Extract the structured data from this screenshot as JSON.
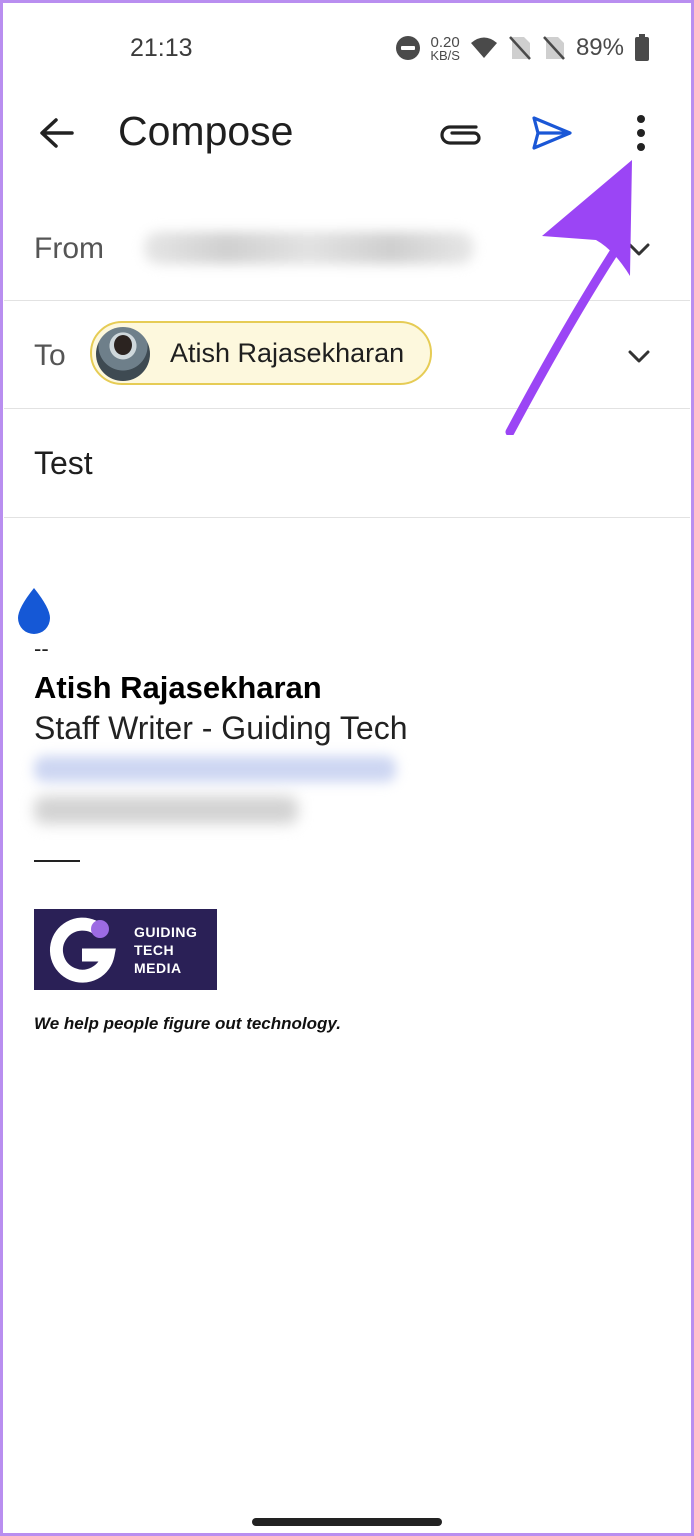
{
  "status_bar": {
    "time": "21:13",
    "net_speed_value": "0.20",
    "net_speed_unit": "KB/S",
    "battery": "89%",
    "icons": [
      "do-not-disturb-icon",
      "wifi-icon",
      "no-sim-icon",
      "no-sim-icon",
      "battery-icon"
    ]
  },
  "app_bar": {
    "title": "Compose",
    "icons": [
      "back-arrow-icon",
      "attachment-icon",
      "send-icon",
      "more-vert-icon"
    ]
  },
  "compose": {
    "from_label": "From",
    "to_label": "To",
    "to_recipient": "Atish Rajasekharan",
    "subject": "Test"
  },
  "body": {
    "signature_dash": "--",
    "signature_name": "Atish Rajasekharan",
    "signature_role": "Staff Writer - Guiding Tech",
    "logo_line1": "GUIDING",
    "logo_line2": "TECH",
    "logo_line3": "MEDIA",
    "tagline": "We help people figure out technology."
  },
  "colors": {
    "accent_send": "#1a57d6",
    "chip_border": "#e6cc55",
    "chip_bg": "#fdf8dd",
    "annotation_arrow": "#9b45f5",
    "logo_bg": "#2a2056",
    "cursor_drop": "#1558d6"
  }
}
